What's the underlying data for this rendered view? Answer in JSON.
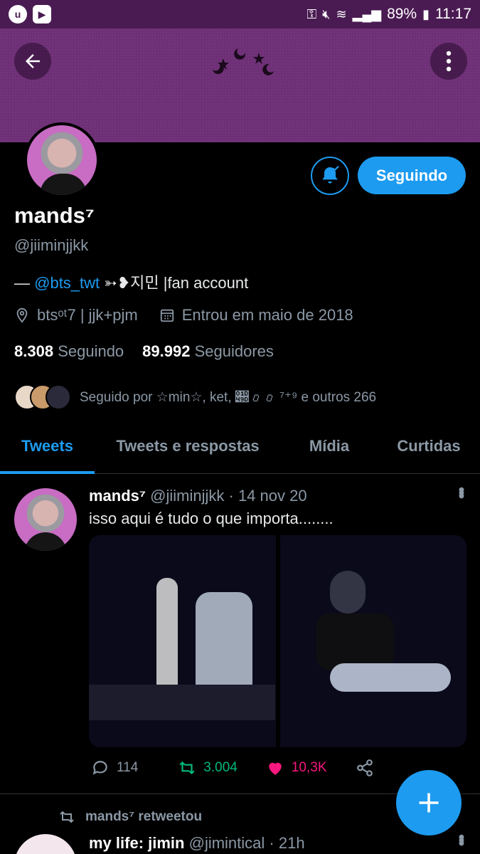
{
  "status_bar": {
    "battery": "89%",
    "time": "11:17"
  },
  "profile": {
    "name": "mands⁷",
    "handle": "@jiiminjjkk",
    "bio_prefix": "— ",
    "bio_mention": "@bts_twt",
    "bio_suffix": " ➳❥지민 |fan account",
    "location": "btsᵒᵗ7 | jjk+pjm",
    "joined": "Entrou em maio de 2018",
    "following_count": "8.308",
    "following_label": "Seguindo",
    "followers_count": "89.992",
    "followers_label": "Seguidores",
    "followed_by": "Seguido por ☆min☆, ket, 𝒝𝑜𝑜 ⁷⁺⁹ e outros 266",
    "follow_button": "Seguindo"
  },
  "tabs": [
    {
      "label": "Tweets",
      "active": true
    },
    {
      "label": "Tweets e respostas",
      "active": false
    },
    {
      "label": "Mídia",
      "active": false
    },
    {
      "label": "Curtidas",
      "active": false
    }
  ],
  "tweet": {
    "author": "mands⁷",
    "handle": "@jiiminjjkk",
    "date": "14 nov 20",
    "text": "isso aqui é tudo o que importa........",
    "replies": "114",
    "retweets": "3.004",
    "likes": "10,3K"
  },
  "retweet": {
    "label": "mands⁷ retweetou",
    "author": "my life: jimin",
    "handle": "@jimintical",
    "time": "21h"
  },
  "colors": {
    "accent": "#1d9bf0",
    "retweet": "#00ba7c",
    "like": "#f91880",
    "status_bar": "#4a1b52",
    "banner": "#6e2f76"
  }
}
